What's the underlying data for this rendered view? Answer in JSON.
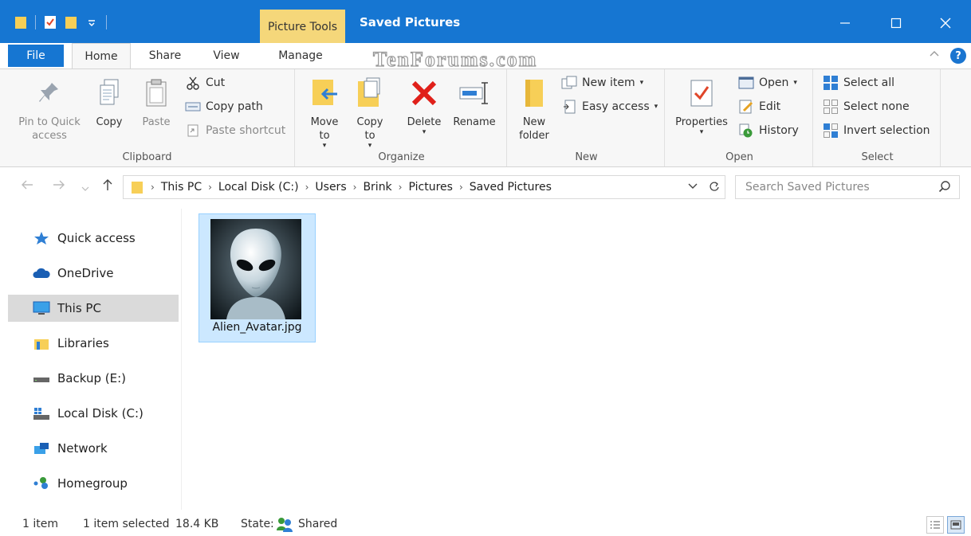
{
  "window": {
    "context_tab": "Picture Tools",
    "title": "Saved Pictures",
    "minimize_icon": "minimize-icon",
    "maximize_icon": "maximize-icon",
    "close_icon": "close-icon"
  },
  "tabs": {
    "file": "File",
    "home": "Home",
    "share": "Share",
    "view": "View",
    "manage": "Manage"
  },
  "watermark": "TenForums.com",
  "ribbon": {
    "clipboard": {
      "label": "Clipboard",
      "pin": "Pin to Quick access",
      "copy": "Copy",
      "paste": "Paste",
      "cut": "Cut",
      "copy_path": "Copy path",
      "paste_shortcut": "Paste shortcut"
    },
    "organize": {
      "label": "Organize",
      "move_to": "Move to",
      "copy_to": "Copy to",
      "delete": "Delete",
      "rename": "Rename"
    },
    "new": {
      "label": "New",
      "new_folder": "New folder",
      "new_item": "New item",
      "easy_access": "Easy access"
    },
    "open": {
      "label": "Open",
      "properties": "Properties",
      "open": "Open",
      "edit": "Edit",
      "history": "History"
    },
    "select": {
      "label": "Select",
      "select_all": "Select all",
      "select_none": "Select none",
      "invert_selection": "Invert selection"
    }
  },
  "address": {
    "crumbs": [
      "This PC",
      "Local Disk (C:)",
      "Users",
      "Brink",
      "Pictures",
      "Saved Pictures"
    ],
    "search_placeholder": "Search Saved Pictures"
  },
  "nav": {
    "items": [
      {
        "label": "Quick access",
        "icon": "star-icon"
      },
      {
        "label": "OneDrive",
        "icon": "cloud-icon"
      },
      {
        "label": "This PC",
        "icon": "monitor-icon"
      },
      {
        "label": "Libraries",
        "icon": "libraries-icon"
      },
      {
        "label": "Backup (E:)",
        "icon": "drive-icon"
      },
      {
        "label": "Local Disk (C:)",
        "icon": "windows-drive-icon"
      },
      {
        "label": "Network",
        "icon": "network-icon"
      },
      {
        "label": "Homegroup",
        "icon": "homegroup-icon"
      }
    ],
    "selected": "This PC"
  },
  "files": [
    {
      "name": "Alien_Avatar.jpg",
      "selected": true
    }
  ],
  "status": {
    "count": "1 item",
    "selected": "1 item selected",
    "size": "18.4 KB",
    "state_label": "State:",
    "state_value": "Shared"
  },
  "colors": {
    "accent": "#1676d2",
    "context_tab": "#f5d77a",
    "selection": "#cce8ff"
  }
}
